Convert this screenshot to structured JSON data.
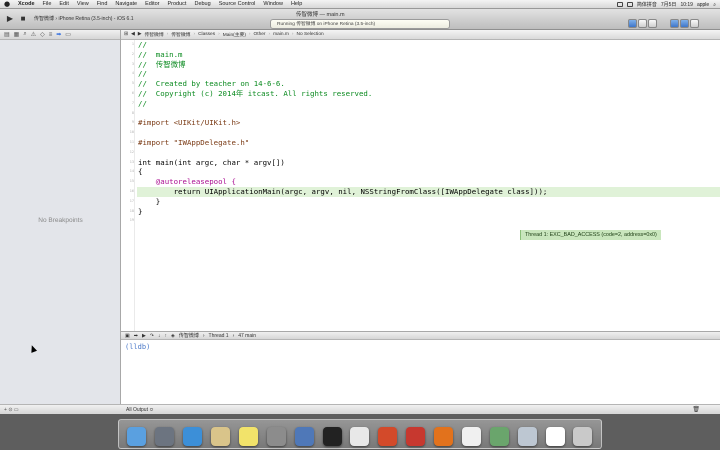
{
  "menubar": {
    "apple_icon": "apple-icon",
    "items": [
      "Xcode",
      "File",
      "Edit",
      "View",
      "Find",
      "Navigate",
      "Editor",
      "Product",
      "Debug",
      "Source Control",
      "Window",
      "Help"
    ],
    "status_date": "7月5日",
    "status_time": "10:19",
    "status_user": "apple",
    "status_input": "简体拼音"
  },
  "toolbar": {
    "window_title": "传智微博 — main.m",
    "scheme": "传智微博",
    "destination": "iPhone Retina (3.5-inch) - iOS 6.1",
    "activity": "Running 传智微博 on iPhone Retina (3.5-inch)"
  },
  "navigator": {
    "empty_text": "No Breakpoints"
  },
  "jumpbar": {
    "crumbs": [
      "传智微博",
      "传智微博",
      "Classes",
      "Main(主要)",
      "Other",
      "main.m",
      "No Selection"
    ]
  },
  "code": {
    "lines": [
      {
        "n": "1",
        "cls": "tok-comment",
        "text": "//"
      },
      {
        "n": "2",
        "cls": "tok-comment",
        "text": "//  main.m"
      },
      {
        "n": "3",
        "cls": "tok-comment",
        "text": "//  传智微博"
      },
      {
        "n": "4",
        "cls": "tok-comment",
        "text": "//"
      },
      {
        "n": "5",
        "cls": "tok-comment",
        "text": "//  Created by teacher on 14-6-6."
      },
      {
        "n": "6",
        "cls": "tok-comment",
        "text": "//  Copyright (c) 2014年 itcast. All rights reserved."
      },
      {
        "n": "7",
        "cls": "tok-comment",
        "text": "//"
      },
      {
        "n": "8",
        "cls": "tok-plain",
        "text": ""
      },
      {
        "n": "9",
        "cls": "tok-preproc",
        "text": "#import <UIKit/UIKit.h>"
      },
      {
        "n": "10",
        "cls": "tok-plain",
        "text": ""
      },
      {
        "n": "11",
        "cls": "tok-preproc",
        "text": "#import \"IWAppDelegate.h\""
      },
      {
        "n": "12",
        "cls": "tok-plain",
        "text": ""
      },
      {
        "n": "13",
        "cls": "tok-plain",
        "text": "int main(int argc, char * argv[])"
      },
      {
        "n": "14",
        "cls": "tok-plain",
        "text": "{"
      },
      {
        "n": "15",
        "cls": "tok-keyword",
        "text": "    @autoreleasepool {"
      },
      {
        "n": "16",
        "cls": "tok-plain",
        "text": "        return UIApplicationMain(argc, argv, nil, NSStringFromClass([IWAppDelegate class]));",
        "hl": true
      },
      {
        "n": "17",
        "cls": "tok-plain",
        "text": "    }"
      },
      {
        "n": "18",
        "cls": "tok-plain",
        "text": "}"
      },
      {
        "n": "19",
        "cls": "tok-plain",
        "text": ""
      }
    ],
    "error_badge": "Thread 1: EXC_BAD_ACCESS (code=2, address=0x0)"
  },
  "debugbar": {
    "crumbs": [
      "传智微博",
      "Thread 1",
      "47 main"
    ]
  },
  "console": {
    "prompt": "(lldb)",
    "footer": "All Output ≎"
  },
  "dock": {
    "icons": [
      {
        "name": "finder-icon",
        "color": "#5aa0e0"
      },
      {
        "name": "launchpad-icon",
        "color": "#6c7480"
      },
      {
        "name": "safari-icon",
        "color": "#3c8fd8"
      },
      {
        "name": "preview-icon",
        "color": "#d9c48a"
      },
      {
        "name": "stickies-icon",
        "color": "#f2e36a"
      },
      {
        "name": "system-preferences-icon",
        "color": "#8c8c8c"
      },
      {
        "name": "xcode-icon",
        "color": "#4f78b8"
      },
      {
        "name": "terminal-icon",
        "color": "#222222"
      },
      {
        "name": "pen-app-icon",
        "color": "#e8e8e8"
      },
      {
        "name": "powerpoint-icon",
        "color": "#d34a2a"
      },
      {
        "name": "sketch-app-icon",
        "color": "#c7382f"
      },
      {
        "name": "firefox-icon",
        "color": "#e2721c"
      },
      {
        "name": "textedit-icon",
        "color": "#f0f0f0"
      },
      {
        "name": "instruments-icon",
        "color": "#6aa56c"
      },
      {
        "name": "image-icon",
        "color": "#bdc7d2"
      },
      {
        "name": "document-icon",
        "color": "#ffffff"
      },
      {
        "name": "trash-icon",
        "color": "#c9c9c9"
      }
    ]
  }
}
